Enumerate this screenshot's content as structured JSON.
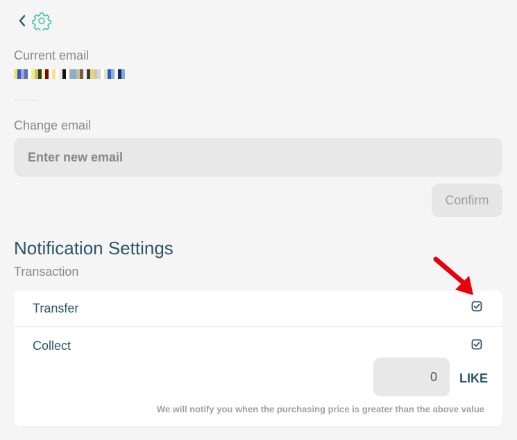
{
  "header": {
    "back_icon": "chevron-left-icon",
    "settings_icon": "gear-icon"
  },
  "account": {
    "current_email_label": "Current email",
    "current_email_value": "(censored)",
    "change_email_label": "Change email",
    "new_email_placeholder": "Enter new email",
    "confirm_label": "Confirm"
  },
  "notifications": {
    "title": "Notification Settings",
    "section_label": "Transaction",
    "rows": [
      {
        "label": "Transfer",
        "checked": true
      },
      {
        "label": "Collect",
        "checked": true
      }
    ],
    "threshold_value": "0",
    "threshold_unit": "LIKE",
    "threshold_note": "We will notify you when the purchasing price is greater than the above value"
  },
  "colors": {
    "accent": "#2b5566",
    "teal": "#40c4a8",
    "muted_text": "#888888",
    "arrow": "#e8000c"
  }
}
